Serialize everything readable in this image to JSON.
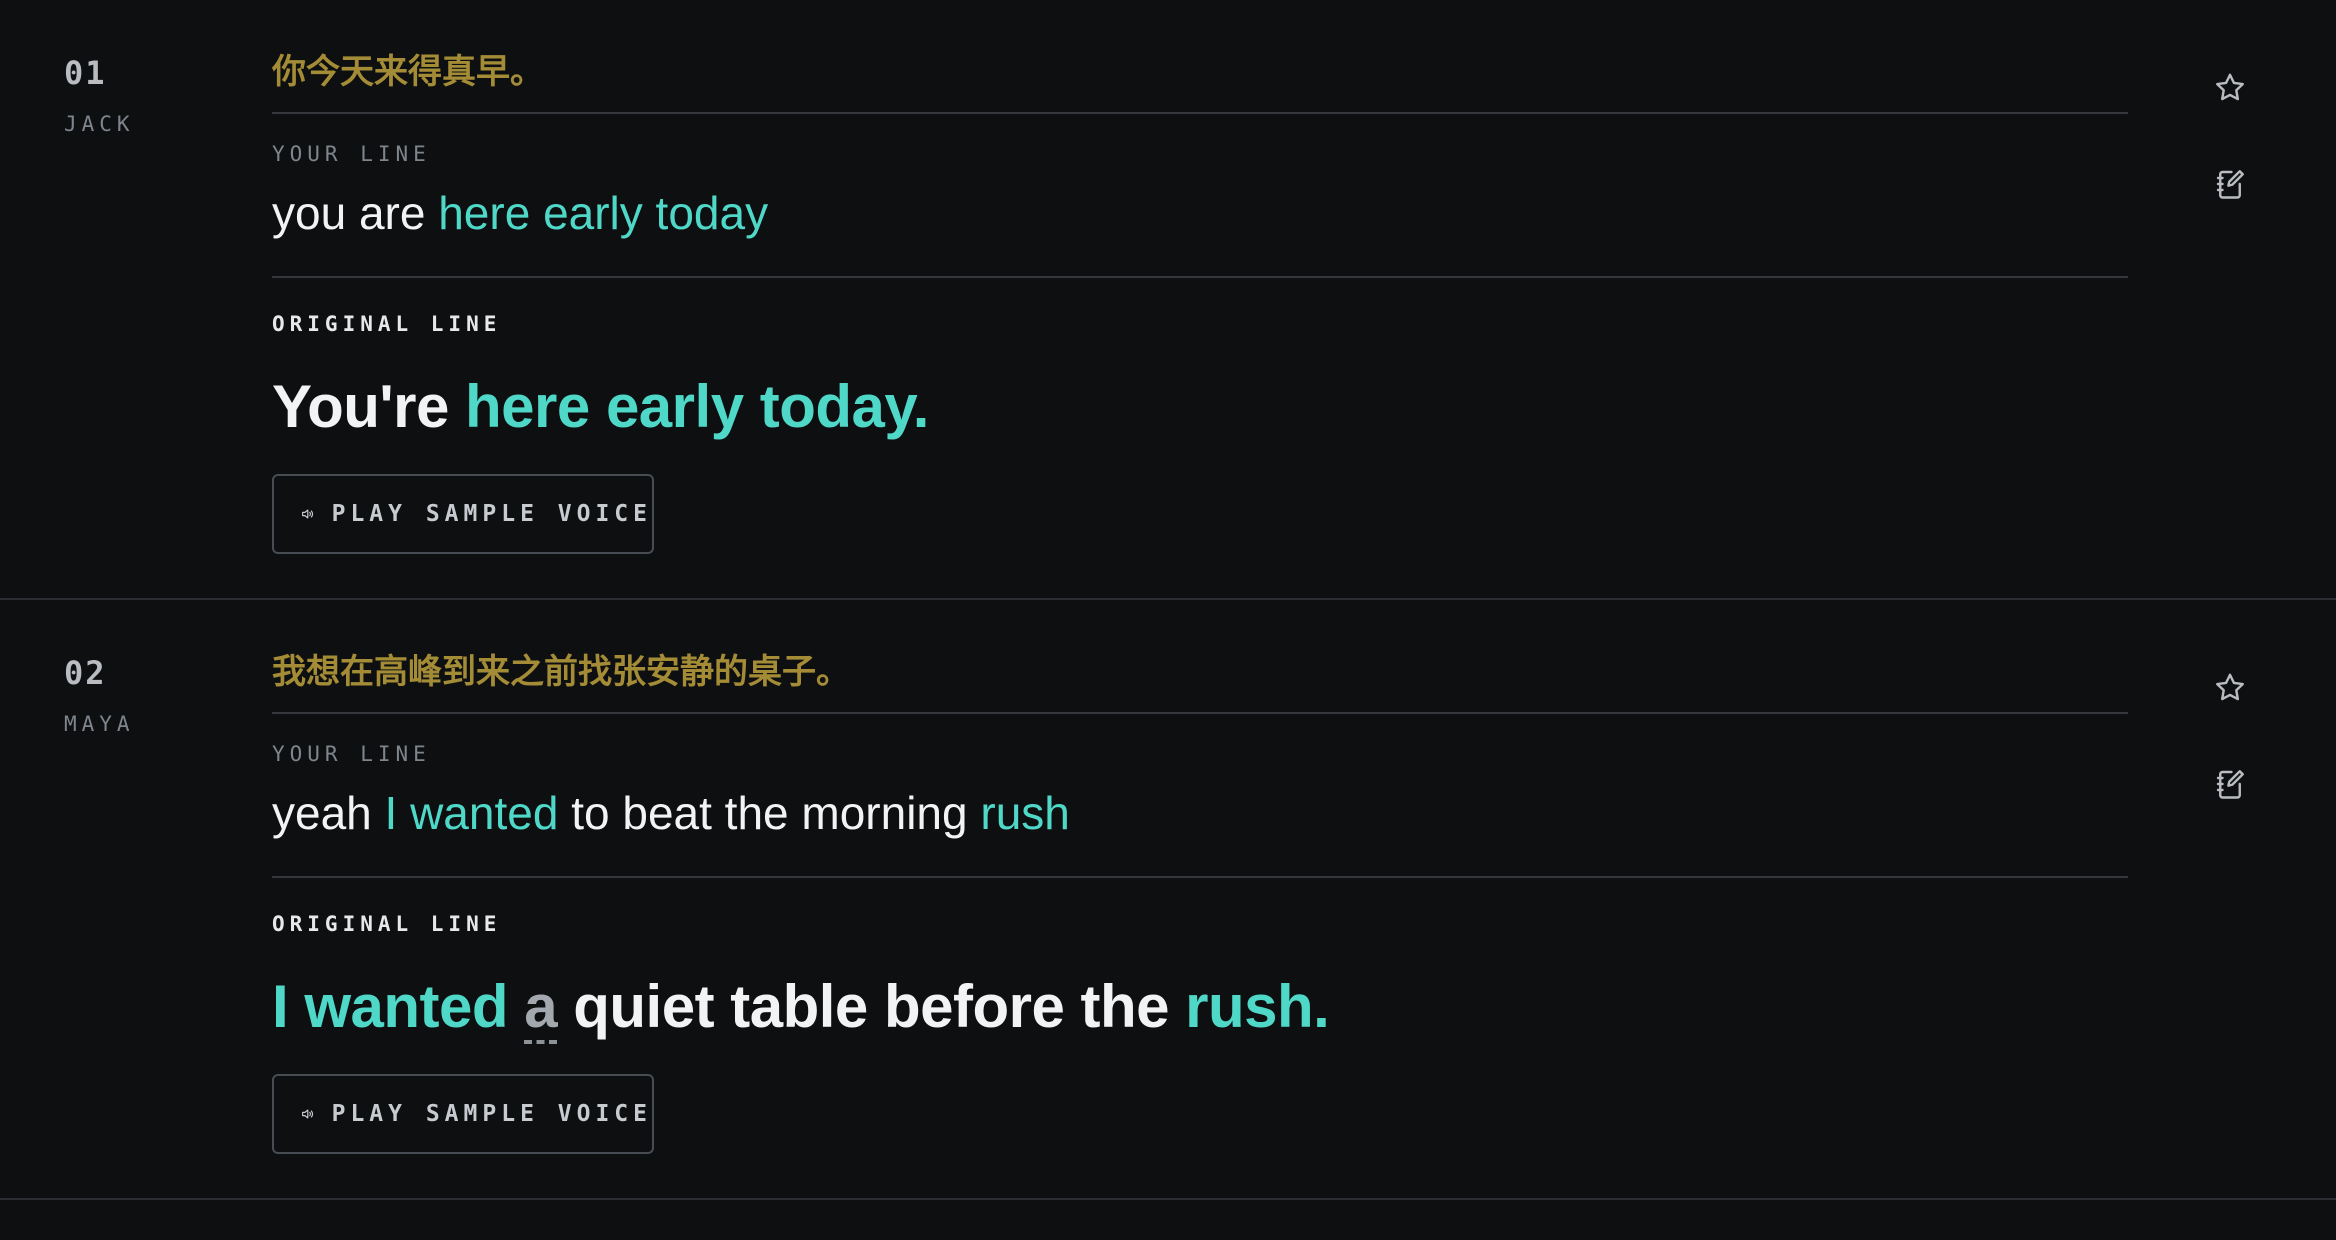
{
  "entries": [
    {
      "number": "01",
      "speaker": "JACK",
      "chinese": "你今天来得真早。",
      "your_line_label": "YOUR LINE",
      "your_line": [
        {
          "text": "you are ",
          "state": "plain"
        },
        {
          "text": "here early today",
          "state": "match"
        }
      ],
      "original_line_label": "ORIGINAL LINE",
      "original_line": [
        {
          "text": "You're ",
          "state": "plain"
        },
        {
          "text": "here early today.",
          "state": "match"
        }
      ],
      "play_button_label": "PLAY SAMPLE VOICE",
      "icons": {
        "favorite": "star-icon",
        "note": "notebook-edit-icon",
        "play": "speaker-icon"
      }
    },
    {
      "number": "02",
      "speaker": "MAYA",
      "chinese": "我想在高峰到来之前找张安静的桌子。",
      "your_line_label": "YOUR LINE",
      "your_line": [
        {
          "text": "yeah ",
          "state": "plain"
        },
        {
          "text": "I wanted",
          "state": "match"
        },
        {
          "text": " to beat the morning ",
          "state": "plain"
        },
        {
          "text": "rush",
          "state": "match"
        }
      ],
      "original_line_label": "ORIGINAL LINE",
      "original_line": [
        {
          "text": "I wanted",
          "state": "match"
        },
        {
          "text": " ",
          "state": "plain"
        },
        {
          "text": "a",
          "state": "missing"
        },
        {
          "text": " quiet table before the ",
          "state": "plain"
        },
        {
          "text": "rush.",
          "state": "match"
        }
      ],
      "play_button_label": "PLAY SAMPLE VOICE",
      "icons": {
        "favorite": "star-icon",
        "note": "notebook-edit-icon",
        "play": "speaker-icon"
      }
    }
  ],
  "colors": {
    "background": "#0d0f11",
    "match": "#4fd8c8",
    "chinese": "#a48c36",
    "missing": "#a3a8ae",
    "text": "#f2f3f4",
    "muted": "#7e858c"
  }
}
